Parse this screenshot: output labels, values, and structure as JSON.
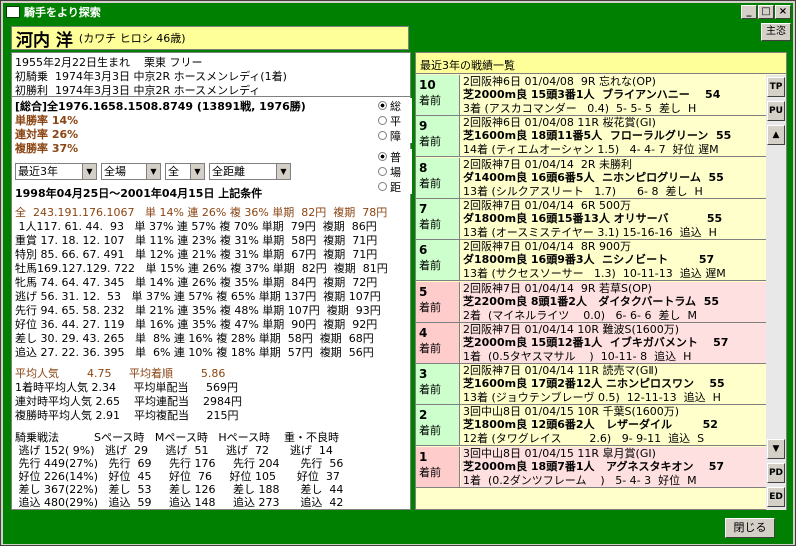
{
  "window": {
    "title": "騎手をより探索",
    "buttons": [
      "_",
      "□",
      "×"
    ]
  },
  "header": {
    "name": "河内 洋",
    "kana": "(カワチ ヒロシ  46歳)",
    "shusei": "主恣"
  },
  "profile": [
    "1955年2月22日生まれ    栗東 フリー",
    "初騎乗  1974年3月3日 中京2R ホースメンレディ(1着)",
    "初勝利  1974年3月3日 中京2R ホースメンレディ"
  ],
  "summary": {
    "total": "[総合]全1976.1658.1508.8749 (13891戦, 1976勝)",
    "win": "単勝率 14%",
    "ren": "連対率 26%",
    "fuku": "複勝率 37%"
  },
  "radio1": [
    "総",
    "平",
    "障"
  ],
  "radio2": [
    "普",
    "場",
    "距"
  ],
  "filters": {
    "period": "最近3年",
    "venue": "全場",
    "course": "全",
    "distance": "全距離"
  },
  "condition": "1998年04月25日～2001年04月15日 上記条件",
  "stats": [
    "全  243.191.176.1067   単 14% 連 26% 複 36% 単期  82円  複期  78円",
    " 1人117. 61. 44.  93   単 37% 連 57% 複 70% 単期  79円  複期  86円",
    "重賞 17. 18. 12. 107   単 11% 連 23% 複 31% 単期  58円  複期  71円",
    "特別 85. 66. 67. 491   単 12% 連 21% 複 31% 単期  67円  複期  71円",
    "牡馬169.127.129. 722   単 15% 連 26% 複 37% 単期  82円  複期  81円",
    "牝馬 74. 64. 47. 345   単 14% 連 26% 複 35% 単期  84円  複期  72円",
    "逃げ 56. 31. 12.  53   単 37% 連 57% 複 65% 単期 137円  複期 107円",
    "先行 94. 65. 58. 232   単 21% 連 35% 複 48% 単期 107円  複期  93円",
    "好位 36. 44. 27. 119   単 16% 連 35% 複 47% 単期  90円  複期  92円",
    "差し 30. 29. 43. 265   単  8% 連 16% 複 28% 単期  58円  複期  68円",
    "追込 27. 22. 36. 395   単  6% 連 10% 複 18% 単期  57円  複期  56円"
  ],
  "avg": [
    "平均人気        4.75     平均着順        5.86",
    "1着時平均人気 2.34     平均単配当     569円",
    "連対時平均人気 2.65    平均連配当    2984円",
    "複勝時平均人気 2.91    平均複配当     215円"
  ],
  "tactics": [
    "騎乗戦法          Sペース時   Mペース時   Hペース時    重・不良時",
    " 逃げ 152( 9%)   逃げ  29     逃げ  51     逃げ  72      逃げ  14",
    " 先行 449(27%)   先行  69     先行 176     先行 204      先行  56",
    " 好位 226(14%)   好位  45     好位  76     好位 105      好位  37",
    " 差し 367(22%)   差し  53     差し 126     差し 188      差し  44",
    " 追込 480(29%)   追込  59     追込 148     追込 273      追込  42"
  ],
  "races_title": "最近3年の戦績一覧",
  "races": [
    {
      "n": "10",
      "k": "着前",
      "l1": "2回阪神6日 01/04/08  9R 忘れな(OP)",
      "l2": "芝2000m良 15頭3番1人  ブライアンハニー    54",
      "l3": "3着 (アスカコマンダー   0.4)  5- 5- 5  差し  H",
      "pink": false
    },
    {
      "n": "9",
      "k": "着前",
      "l1": "2回阪神6日 01/04/08 11R 桜花賞(GⅠ)",
      "l2": "芝1600m良 18頭11番5人  フローラルグリーン  55",
      "l3": "14着 (ティエムオーシャン 1.5)   4- 4- 7  好位 遅M",
      "pink": false
    },
    {
      "n": "8",
      "k": "着前",
      "l1": "2回阪神7日 01/04/14  2R 未勝利",
      "l2": "ダ1400m良 16頭6番5人  ニホンピログリーム  55",
      "l3": "13着 (シルクアスリート   1.7)      6- 8  差し  H",
      "pink": false
    },
    {
      "n": "7",
      "k": "着前",
      "l1": "2回阪神7日 01/04/14  6R 500万",
      "l2": "ダ1800m良 16頭15番13人 オリサーバ          55",
      "l3": "13着 (オースミステイヤー 3.1) 15-16-16  追込  H",
      "pink": false
    },
    {
      "n": "6",
      "k": "着前",
      "l1": "2回阪神7日 01/04/14  8R 900万",
      "l2": "ダ1800m良 16頭9番3人  ニシノビート        57",
      "l3": "13着 (サクセスソーサー   1.3)  10-11-13  追込 遅M",
      "pink": false
    },
    {
      "n": "5",
      "k": "着前",
      "l1": "2回阪神7日 01/04/14  9R 若草S(OP)",
      "l2": "芝2200m良 8頭1番2人   ダイタクバートラム  55",
      "l3": "2着  (マイネルライツ    0.0)   6- 6- 6  差し  M",
      "pink": true
    },
    {
      "n": "4",
      "k": "着前",
      "l1": "2回阪神7日 01/04/14 10R 難波S(1600万)",
      "l2": "芝2000m良 15頭12番1人  イブキガバメント    57",
      "l3": "1着  (0.5タヤスマサル    )  10-11- 8  追込  H",
      "pink": true
    },
    {
      "n": "3",
      "k": "着前",
      "l1": "2回阪神7日 01/04/14 11R 読売マ(GⅡ)",
      "l2": "芝1600m良 17頭2番12人 ニホンピロスワン    55",
      "l3": "13着 (ジョウテンブレーヴ 0.5)  12-11-13  追込  H",
      "pink": false
    },
    {
      "n": "2",
      "k": "着前",
      "l1": "3回中山8日 01/04/15 10R 千葉S(1600万)",
      "l2": "芝1800m良 12頭6番2人   レザーダイル        52",
      "l3": "12着 (タワグレイス        2.6)   9- 9-11  追込  S",
      "pink": false
    },
    {
      "n": "1",
      "k": "着前",
      "l1": "3回中山8日 01/04/15 11R 皐月賞(GⅠ)",
      "l2": "芝2000m良 18頭7番1人   アグネスタキオン    57",
      "l3": "1着  (0.2ダンツフレーム    )   5- 4- 3  好位  M",
      "pink": true
    }
  ],
  "side_buttons": [
    "TP",
    "PU",
    "▲",
    "▼",
    "PD",
    "ED"
  ],
  "close_label": "閉じる"
}
